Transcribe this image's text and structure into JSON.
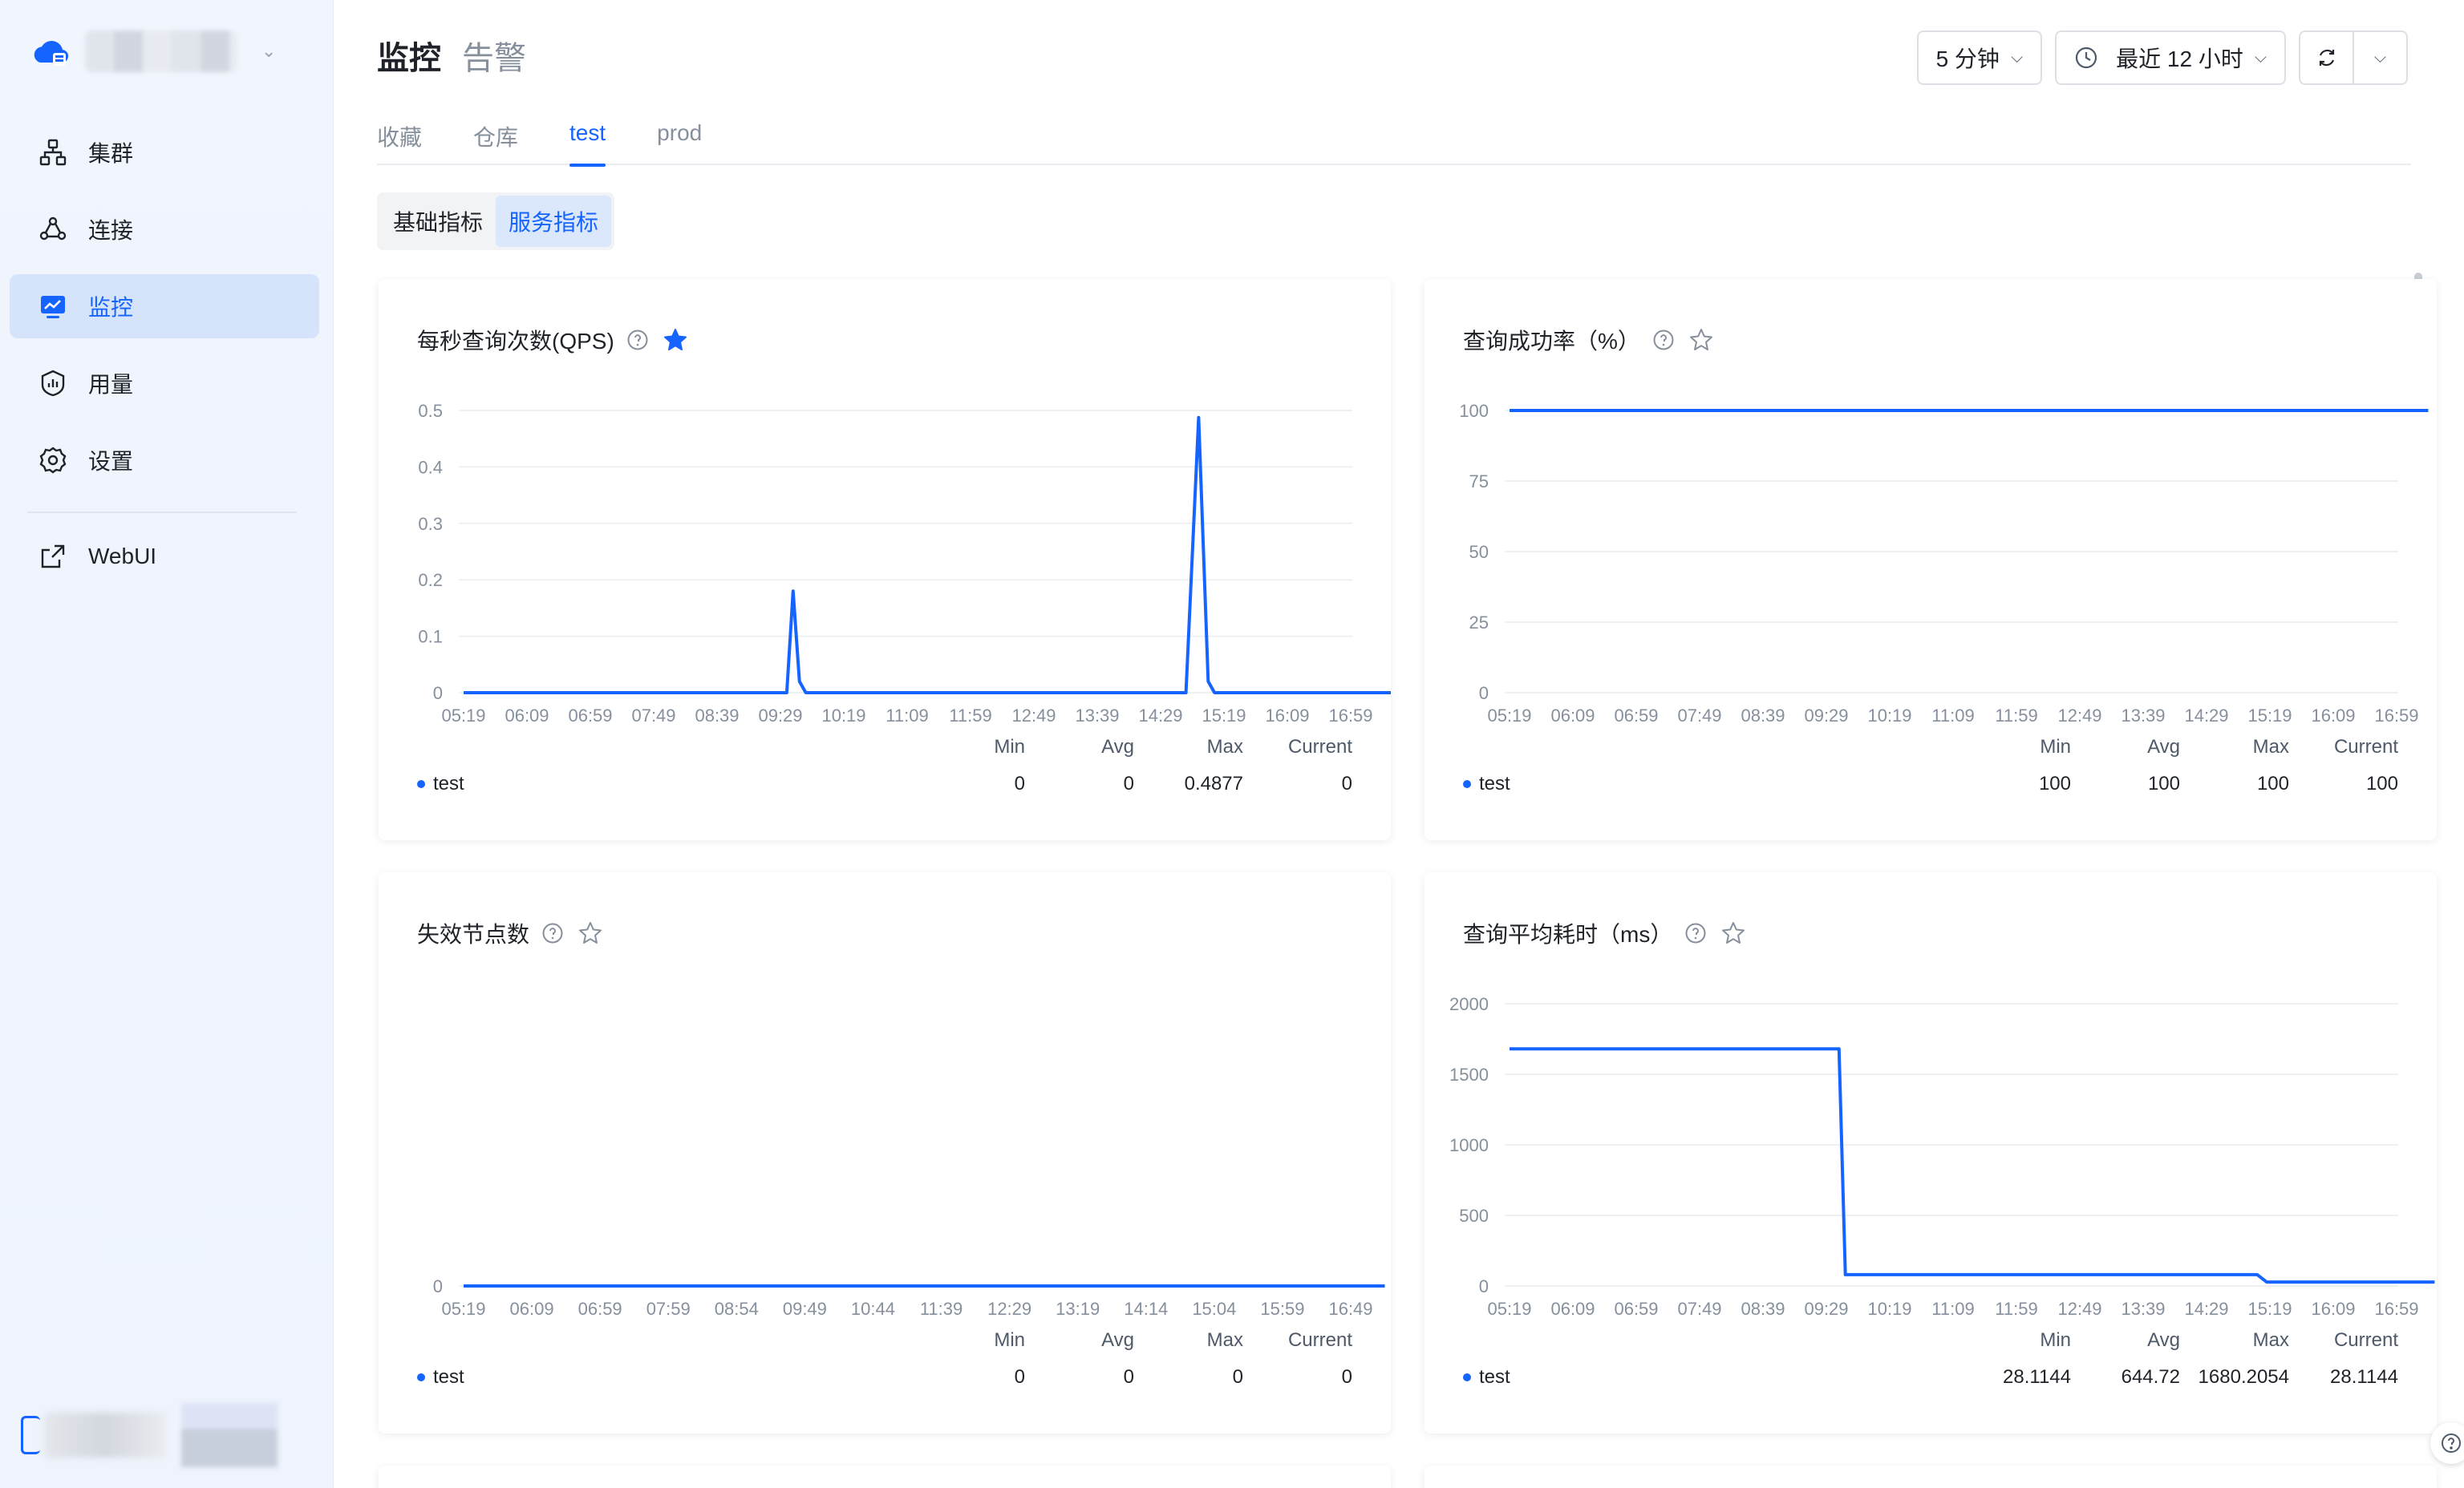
{
  "sidebar": {
    "items": [
      {
        "label": "集群",
        "icon": "cluster-icon",
        "active": false
      },
      {
        "label": "连接",
        "icon": "connection-icon",
        "active": false
      },
      {
        "label": "监控",
        "icon": "monitor-icon",
        "active": true
      },
      {
        "label": "用量",
        "icon": "usage-icon",
        "active": false
      },
      {
        "label": "设置",
        "icon": "settings-icon",
        "active": false
      }
    ],
    "webui_label": "WebUI"
  },
  "header": {
    "title": "监控",
    "alert_tab": "告警",
    "interval": "5 分钟",
    "time_range": "最近 12 小时"
  },
  "tabs": [
    "收藏",
    "仓库",
    "test",
    "prod"
  ],
  "active_tab": "test",
  "subtabs": [
    "基础指标",
    "服务指标"
  ],
  "active_subtab": "服务指标",
  "colors": {
    "accent": "#1664ff",
    "grid": "#eef0f4",
    "axis_text": "#86909c"
  },
  "stats_headers": [
    "Min",
    "Avg",
    "Max",
    "Current"
  ],
  "chart_data": [
    {
      "type": "line",
      "title": "每秒查询次数(QPS)",
      "favorited": true,
      "yticks": [
        "0",
        "0.1",
        "0.2",
        "0.3",
        "0.4",
        "0.5"
      ],
      "ylim": [
        0,
        0.5
      ],
      "x": [
        "05:19",
        "06:09",
        "06:59",
        "07:49",
        "08:39",
        "09:29",
        "10:19",
        "11:09",
        "11:59",
        "12:49",
        "13:39",
        "14:29",
        "15:19",
        "16:09",
        "16:59"
      ],
      "series": [
        {
          "name": "test",
          "points": [
            [
              0,
              0
            ],
            [
              5.1,
              0
            ],
            [
              5.2,
              0.18
            ],
            [
              5.3,
              0.02
            ],
            [
              5.4,
              0
            ],
            [
              11.4,
              0
            ],
            [
              11.6,
              0.4877
            ],
            [
              11.75,
              0.02
            ],
            [
              11.85,
              0
            ],
            [
              14.8,
              0
            ]
          ]
        }
      ],
      "stats": [
        "0",
        "0",
        "0.4877",
        "0"
      ]
    },
    {
      "type": "line",
      "title": "查询成功率（%）",
      "favorited": false,
      "yticks": [
        "0",
        "25",
        "50",
        "75",
        "100"
      ],
      "ylim": [
        0,
        100
      ],
      "x": [
        "05:19",
        "06:09",
        "06:59",
        "07:49",
        "08:39",
        "09:29",
        "10:19",
        "11:09",
        "11:59",
        "12:49",
        "13:39",
        "14:29",
        "15:19",
        "16:09",
        "16:59"
      ],
      "series": [
        {
          "name": "test",
          "points": [
            [
              0,
              100
            ],
            [
              14.5,
              100
            ]
          ]
        }
      ],
      "stats": [
        "100",
        "100",
        "100",
        "100"
      ]
    },
    {
      "type": "line",
      "title": "失效节点数",
      "favorited": false,
      "yticks": [
        "0"
      ],
      "ylim": [
        0,
        1
      ],
      "x": [
        "05:19",
        "06:09",
        "06:59",
        "07:59",
        "08:54",
        "09:49",
        "10:44",
        "11:39",
        "12:29",
        "13:19",
        "14:14",
        "15:04",
        "15:59",
        "16:49"
      ],
      "series": [
        {
          "name": "test",
          "points": [
            [
              0,
              0
            ],
            [
              13.5,
              0
            ]
          ]
        }
      ],
      "stats": [
        "0",
        "0",
        "0",
        "0"
      ]
    },
    {
      "type": "line",
      "title": "查询平均耗时（ms）",
      "favorited": false,
      "yticks": [
        "0",
        "500",
        "1000",
        "1500",
        "2000"
      ],
      "ylim": [
        0,
        2000
      ],
      "x": [
        "05:19",
        "06:09",
        "06:59",
        "07:49",
        "08:39",
        "09:29",
        "10:19",
        "11:09",
        "11:59",
        "12:49",
        "13:39",
        "14:29",
        "15:19",
        "16:09",
        "16:59"
      ],
      "series": [
        {
          "name": "test",
          "points": [
            [
              0,
              1680
            ],
            [
              5.2,
              1680
            ],
            [
              5.3,
              80
            ],
            [
              11.8,
              80
            ],
            [
              11.95,
              28
            ],
            [
              14.6,
              28
            ]
          ]
        }
      ],
      "stats": [
        "28.1144",
        "644.72",
        "1680.2054",
        "28.1144"
      ]
    }
  ]
}
